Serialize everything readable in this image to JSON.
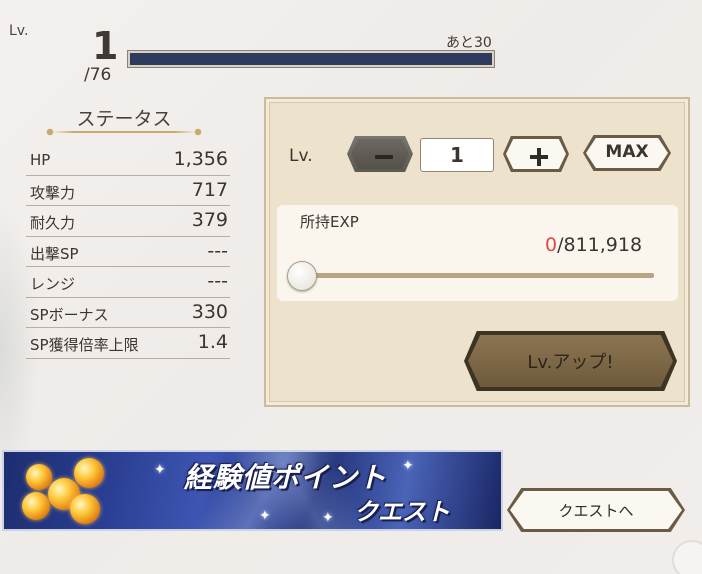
{
  "level": {
    "prefix": "Lv.",
    "current": "1",
    "max": "/76",
    "remaining": "あと30"
  },
  "status": {
    "title": "ステータス",
    "rows": [
      {
        "name": "HP",
        "value": "1,356"
      },
      {
        "name": "攻撃力",
        "value": "717"
      },
      {
        "name": "耐久力",
        "value": "379"
      },
      {
        "name": "出撃SP",
        "value": "---"
      },
      {
        "name": "レンジ",
        "value": "---"
      },
      {
        "name": "SPボーナス",
        "value": "330"
      },
      {
        "name": "SP獲得倍率上限",
        "value": "1.4"
      }
    ]
  },
  "levelup": {
    "lv_label": "Lv.",
    "lv_value": "1",
    "max_label": "MAX",
    "exp_label": "所持EXP",
    "exp_current": "0",
    "exp_total": "/811,918",
    "slider_fraction": 0,
    "button_label": "Lv.アップ!"
  },
  "quest": {
    "banner_title_line1": "経験値ポイント",
    "banner_title_line2": "クエスト",
    "button_label": "クエストへ"
  },
  "colors": {
    "exp_bar": "#2e3a5e",
    "exp_current": "#d94a4a",
    "panel": "#ede3cc"
  }
}
